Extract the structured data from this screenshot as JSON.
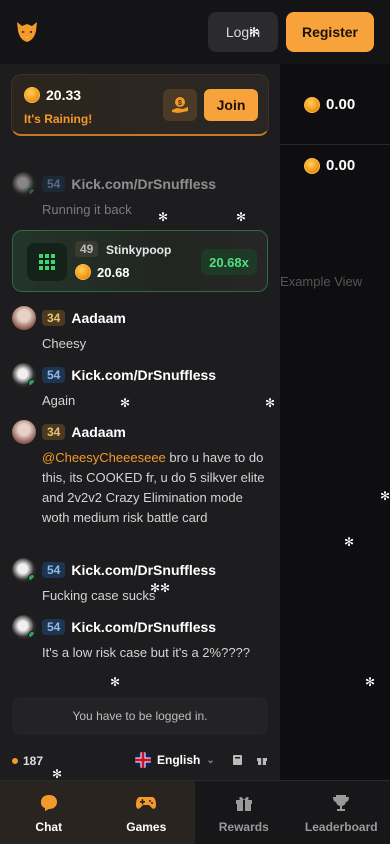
{
  "header": {
    "login_label": "Login",
    "register_label": "Register"
  },
  "background": {
    "rows": [
      {
        "value": "0.00"
      },
      {
        "value": "0.00"
      }
    ],
    "faint_text": "Example View"
  },
  "rain": {
    "amount": "20.33",
    "label": "It's Raining!",
    "join_label": "Join"
  },
  "messages": [
    {
      "level": "54",
      "user": "Kick.com/DrSnuffless",
      "text": "Running it back"
    },
    {
      "level": "34",
      "user": "Aadaam",
      "text": "Cheesy"
    },
    {
      "level": "54",
      "user": "Kick.com/DrSnuffless",
      "text": "Again"
    },
    {
      "level": "34",
      "user": "Aadaam",
      "mention": "@CheesyCheeeseee",
      "text": " bro u have to do this, its COOKED fr, u do 5 silkver elite and 2v2v2 Crazy Elimination mode woth medium risk battle card"
    },
    {
      "level": "54",
      "user": "Kick.com/DrSnuffless",
      "text": "Fucking case sucks"
    },
    {
      "level": "54",
      "user": "Kick.com/DrSnuffless",
      "text": "It's a low risk case but it's a 2%????"
    }
  ],
  "win": {
    "level": "49",
    "user": "Stinkypoop",
    "value": "20.68",
    "multiplier": "20.68x"
  },
  "login_note": "You have to be logged in.",
  "footer": {
    "online_count": "187",
    "language": "English"
  },
  "nav": [
    {
      "label": "Chat",
      "icon": "chat-bubble-icon"
    },
    {
      "label": "Games",
      "icon": "gamepad-icon"
    },
    {
      "label": "Rewards",
      "icon": "gift-icon"
    },
    {
      "label": "Leaderboard",
      "icon": "trophy-icon"
    }
  ],
  "colors": {
    "accent": "#f7a23a",
    "win_green": "#4fe07f",
    "background": "#111113",
    "chat_panel": "#1d1d1f"
  }
}
